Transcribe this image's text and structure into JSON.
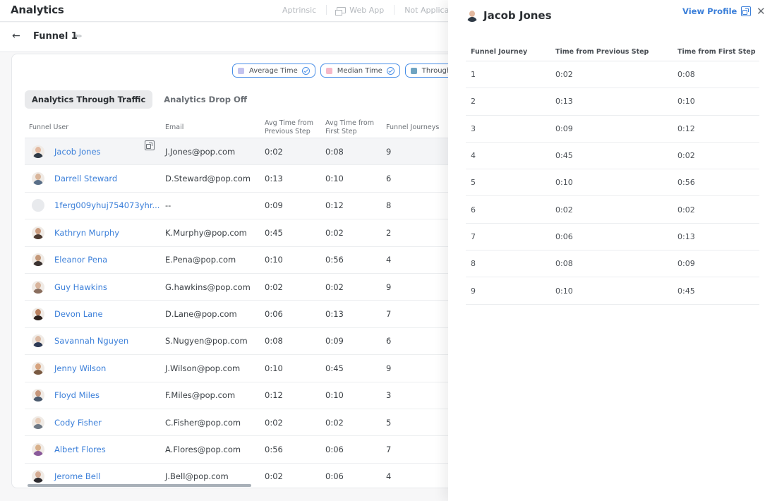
{
  "app": {
    "title": "Analytics",
    "meta": {
      "product": "Aptrinsic",
      "app_type": "Web App",
      "status": "Not Applica"
    }
  },
  "funnel": {
    "back_icon": "arrow-left-icon",
    "title": "Funnel 1",
    "edit_icon": "pencil-icon"
  },
  "legend": [
    {
      "label": "Average Time",
      "color": "#c3c3ee"
    },
    {
      "label": "Median Time",
      "color": "#f6b8c8"
    },
    {
      "label": "Through Tr",
      "color": "#6fa4c1"
    }
  ],
  "tabs": [
    {
      "label": "Analytics Through Traffic",
      "active": true
    },
    {
      "label": "Analytics Drop Off",
      "active": false
    }
  ],
  "table": {
    "headers": {
      "user": "Funnel User",
      "email": "Email",
      "prev_line1": "Avg Time from",
      "prev_line2": "Previous Step",
      "first_line1": "Avg Time from",
      "first_line2": "First Step",
      "journeys": "Funnel Journeys"
    },
    "rows": [
      {
        "name": "Jacob Jones",
        "email": "J.Jones@pop.com",
        "prev": "0:02",
        "first": "0:08",
        "journeys": "9",
        "skin": "#e3b9a0",
        "shirt": "#2f3a46",
        "selected": true
      },
      {
        "name": "Darrell Steward",
        "email": "D.Steward@pop.com",
        "prev": "0:13",
        "first": "0:10",
        "journeys": "6",
        "skin": "#d9b59a",
        "shirt": "#5a6f88"
      },
      {
        "name": "1ferg009yhuj754073yhr...",
        "email": "--",
        "prev": "0:09",
        "first": "0:12",
        "journeys": "8",
        "skin": "#e8eaed",
        "shirt": "#e8eaed"
      },
      {
        "name": "Kathryn Murphy",
        "email": "K.Murphy@pop.com",
        "prev": "0:45",
        "first": "0:02",
        "journeys": "2",
        "skin": "#c99a7c",
        "shirt": "#4b3a30"
      },
      {
        "name": "Eleanor Pena",
        "email": "E.Pena@pop.com",
        "prev": "0:10",
        "first": "0:56",
        "journeys": "4",
        "skin": "#c49878",
        "shirt": "#3a3230"
      },
      {
        "name": "Guy Hawkins",
        "email": "G.hawkins@pop.com",
        "prev": "0:02",
        "first": "0:02",
        "journeys": "9",
        "skin": "#d8b49c",
        "shirt": "#8a6e5e"
      },
      {
        "name": "Devon Lane",
        "email": "D.Lane@pop.com",
        "prev": "0:06",
        "first": "0:13",
        "journeys": "7",
        "skin": "#b9805e",
        "shirt": "#2a201c"
      },
      {
        "name": "Savannah Nguyen",
        "email": "S.Nugyen@pop.com",
        "prev": "0:08",
        "first": "0:09",
        "journeys": "6",
        "skin": "#dcb9a2",
        "shirt": "#2d3a55"
      },
      {
        "name": "Jenny Wilson",
        "email": "J.Wilson@pop.com",
        "prev": "0:10",
        "first": "0:45",
        "journeys": "9",
        "skin": "#d6a37e",
        "shirt": "#7a5a42"
      },
      {
        "name": "Floyd Miles",
        "email": "F.Miles@pop.com",
        "prev": "0:12",
        "first": "0:10",
        "journeys": "3",
        "skin": "#c6967a",
        "shirt": "#4a5a6e"
      },
      {
        "name": "Cody Fisher",
        "email": "C.Fisher@pop.com",
        "prev": "0:02",
        "first": "0:02",
        "journeys": "5",
        "skin": "#e6ccb8",
        "shirt": "#6e7884"
      },
      {
        "name": "Albert Flores",
        "email": "A.Flores@pop.com",
        "prev": "0:56",
        "first": "0:06",
        "journeys": "7",
        "skin": "#d8b08a",
        "shirt": "#8a5a9a"
      },
      {
        "name": "Jerome Bell",
        "email": "J.Bell@pop.com",
        "prev": "0:02",
        "first": "0:06",
        "journeys": "4",
        "skin": "#d4ab92",
        "shirt": "#2c2a2e"
      }
    ]
  },
  "drawer": {
    "title": "Jacob Jones",
    "view_profile": "View Profile",
    "close_icon": "close-icon",
    "headers": {
      "step": "Funnel Journey",
      "prev": "Time from Previous Step",
      "first": "Time from First Step"
    },
    "rows": [
      {
        "step": "1",
        "prev": "0:02",
        "first": "0:08"
      },
      {
        "step": "2",
        "prev": "0:13",
        "first": "0:10"
      },
      {
        "step": "3",
        "prev": "0:09",
        "first": "0:12"
      },
      {
        "step": "4",
        "prev": "0:45",
        "first": "0:02"
      },
      {
        "step": "5",
        "prev": "0:10",
        "first": "0:56"
      },
      {
        "step": "6",
        "prev": "0:02",
        "first": "0:02"
      },
      {
        "step": "7",
        "prev": "0:06",
        "first": "0:13"
      },
      {
        "step": "8",
        "prev": "0:08",
        "first": "0:09"
      },
      {
        "step": "9",
        "prev": "0:10",
        "first": "0:45"
      }
    ]
  }
}
